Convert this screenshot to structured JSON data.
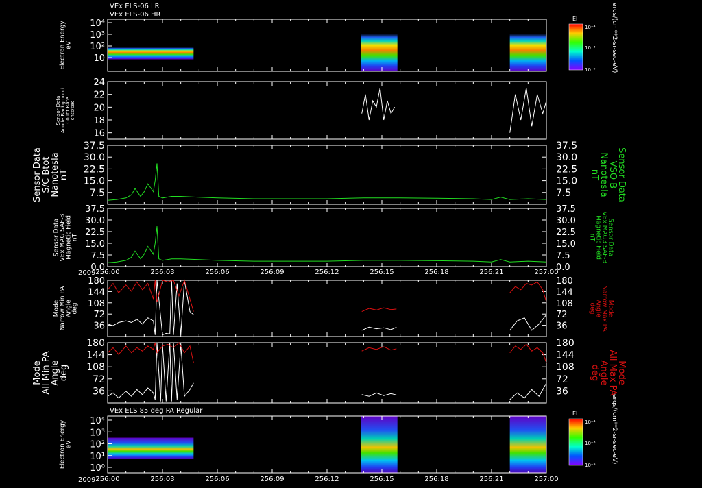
{
  "colors": {
    "background": "#000000",
    "axis": "#ffffff",
    "white_trace": "#ffffff",
    "green_trace": "#22dd22",
    "red_trace": "#dd1111"
  },
  "header": {
    "line1": "VEx ELS-06 LR",
    "line2": "VEx ELS-06 HR"
  },
  "colorbar": {
    "title": "EI",
    "ticks": [
      "10⁻⁴",
      "10⁻⁸",
      "10⁻⁹"
    ],
    "unit": "ergs/(cm**2-sr-sec-eV)"
  },
  "time_axis": {
    "year": "2009",
    "ticks": [
      "256:00",
      "256:03",
      "256:06",
      "256:09",
      "256:12",
      "256:15",
      "256:18",
      "256:21",
      "257:00"
    ]
  },
  "chart_data": [
    {
      "type": "heatmap",
      "id": "energy_top",
      "ylabel": "Electron Energy\neV",
      "yticks": [
        "10⁴",
        "10³",
        "10²",
        "10"
      ],
      "data_intervals_hours": [
        [
          0.0,
          4.7
        ],
        [
          13.85,
          15.85
        ],
        [
          22.0,
          24.0
        ]
      ]
    },
    {
      "type": "line",
      "id": "anode_bg",
      "ylabel": "Sensor Data\nAnode Background\nCount Rate\ncnts/sec",
      "ylim": [
        15,
        24
      ],
      "yticks": [
        "24",
        "22",
        "20",
        "18",
        "16"
      ],
      "series": [
        {
          "color": "white",
          "segments": [
            {
              "x": [
                13.9,
                14.1,
                14.3,
                14.5,
                14.7,
                14.9,
                15.1,
                15.3,
                15.5,
                15.7
              ],
              "y": [
                19,
                22,
                18,
                21,
                20,
                23,
                18,
                21,
                19,
                20
              ]
            },
            {
              "x": [
                22.0,
                22.3,
                22.6,
                22.9,
                23.2,
                23.5,
                23.8,
                24.0
              ],
              "y": [
                16,
                22,
                18,
                23,
                17,
                22,
                19,
                21
              ]
            }
          ]
        }
      ]
    },
    {
      "type": "line",
      "id": "sc_btot",
      "ylabel": "Sensor Data\nS/C Btot\nNanotesla\nnT",
      "ylabel_right": "Sensor Data\nVSO B\nNanotesla\nnT",
      "ylim": [
        0,
        37.5
      ],
      "yticks": [
        "37.5",
        "30.0",
        "22.5",
        "15.0",
        "7.5"
      ],
      "series": [
        {
          "color": "green",
          "x": [
            0,
            0.5,
            1.0,
            1.3,
            1.5,
            1.8,
            2.0,
            2.2,
            2.5,
            2.6,
            2.7,
            2.8,
            3.0,
            3.5,
            4.0,
            5.0,
            6.0,
            8.0,
            10.0,
            12.0,
            14.0,
            16.0,
            18.0,
            20.0,
            21.0,
            21.5,
            22.0,
            23.0,
            24.0
          ],
          "y": [
            2.5,
            3.0,
            4.0,
            6.0,
            10.0,
            5.0,
            8.0,
            13.0,
            8.0,
            15.0,
            26.0,
            5.0,
            4.0,
            5.0,
            5.0,
            4.5,
            4.0,
            3.5,
            3.5,
            3.5,
            4.0,
            4.0,
            3.8,
            3.5,
            3.0,
            4.5,
            3.0,
            3.5,
            3.0
          ]
        }
      ]
    },
    {
      "type": "line",
      "id": "mag_field",
      "ylabel": "Sensor Data\nVEx MAG SAF-B\nMagnetic Field\nnT",
      "ylabel_right": "Sensor Data\nVEx MAG3 SAF-B\nMagnetic Field\nnT",
      "ylim": [
        0,
        37.5
      ],
      "yticks": [
        "37.5",
        "30.0",
        "22.5",
        "15.0",
        "7.5",
        "0.0"
      ],
      "series": [
        {
          "color": "green",
          "x": [
            0,
            0.5,
            1.0,
            1.3,
            1.5,
            1.8,
            2.0,
            2.2,
            2.5,
            2.6,
            2.7,
            2.8,
            3.0,
            3.5,
            4.0,
            5.0,
            6.0,
            8.0,
            10.0,
            12.0,
            14.0,
            16.0,
            18.0,
            20.0,
            21.0,
            21.5,
            22.0,
            23.0,
            24.0
          ],
          "y": [
            2.5,
            3.0,
            4.0,
            6.0,
            10.0,
            5.0,
            8.0,
            13.0,
            8.0,
            15.0,
            26.0,
            5.0,
            4.0,
            5.0,
            5.0,
            4.5,
            4.0,
            3.5,
            3.5,
            3.5,
            4.0,
            4.0,
            3.8,
            3.5,
            3.0,
            4.5,
            3.0,
            3.5,
            3.0
          ]
        }
      ]
    },
    {
      "type": "line",
      "id": "narrow_pa",
      "ylabel": "Mode\nNarrow Min PA\nAngle\ndeg",
      "ylabel_right": "Mode\nNarrow Max PA\nAngle\ndeg",
      "ylim": [
        0,
        180
      ],
      "yticks": [
        "180",
        "144",
        "108",
        "72",
        "36"
      ],
      "series": [
        {
          "name": "min",
          "color": "white",
          "segments": [
            {
              "x": [
                0,
                0.3,
                0.6,
                1.0,
                1.3,
                1.6,
                1.9,
                2.2,
                2.5,
                2.6,
                2.7,
                3.0,
                3.2,
                3.4,
                3.5,
                3.6,
                3.8,
                4.0,
                4.2,
                4.5,
                4.7
              ],
              "y": [
                40,
                35,
                45,
                50,
                45,
                55,
                40,
                60,
                50,
                5,
                180,
                5,
                10,
                8,
                180,
                5,
                170,
                5,
                180,
                80,
                70
              ]
            },
            {
              "x": [
                13.9,
                14.3,
                14.7,
                15.1,
                15.5,
                15.8
              ],
              "y": [
                20,
                30,
                25,
                28,
                22,
                30
              ]
            },
            {
              "x": [
                22.0,
                22.4,
                22.8,
                23.2,
                23.6,
                24.0
              ],
              "y": [
                20,
                50,
                60,
                20,
                40,
                70
              ]
            }
          ]
        },
        {
          "name": "max",
          "color": "red",
          "segments": [
            {
              "x": [
                0,
                0.3,
                0.6,
                1.0,
                1.3,
                1.6,
                1.9,
                2.2,
                2.5,
                2.6,
                2.7,
                3.0,
                3.3,
                3.6,
                3.9,
                4.2,
                4.5,
                4.7
              ],
              "y": [
                150,
                170,
                140,
                165,
                145,
                175,
                150,
                170,
                120,
                180,
                110,
                180,
                175,
                180,
                130,
                180,
                120,
                80
              ]
            },
            {
              "x": [
                13.9,
                14.3,
                14.7,
                15.1,
                15.5,
                15.8
              ],
              "y": [
                80,
                90,
                85,
                92,
                86,
                88
              ]
            },
            {
              "x": [
                22.0,
                22.3,
                22.6,
                22.9,
                23.2,
                23.5,
                23.8,
                24.0
              ],
              "y": [
                140,
                160,
                150,
                170,
                165,
                175,
                150,
                110
              ]
            }
          ]
        }
      ]
    },
    {
      "type": "line",
      "id": "all_pa",
      "ylabel": "Mode\nAll Min PA\nAngle\ndeg",
      "ylabel_right": "Mode\nAll Max PA\nAngle\ndeg",
      "ylim": [
        0,
        180
      ],
      "yticks": [
        "180",
        "144",
        "108",
        "72",
        "36"
      ],
      "series": [
        {
          "name": "min",
          "color": "white",
          "segments": [
            {
              "x": [
                0,
                0.3,
                0.6,
                1.0,
                1.3,
                1.6,
                1.9,
                2.2,
                2.5,
                2.6,
                2.7,
                2.9,
                3.0,
                3.2,
                3.4,
                3.5,
                3.6,
                3.8,
                4.0,
                4.2,
                4.5,
                4.7
              ],
              "y": [
                20,
                30,
                15,
                35,
                20,
                40,
                25,
                45,
                30,
                10,
                180,
                5,
                175,
                5,
                180,
                5,
                180,
                10,
                175,
                20,
                40,
                60
              ]
            },
            {
              "x": [
                13.9,
                14.3,
                14.7,
                15.1,
                15.5,
                15.8
              ],
              "y": [
                25,
                20,
                30,
                22,
                28,
                24
              ]
            },
            {
              "x": [
                22.0,
                22.4,
                22.8,
                23.2,
                23.6,
                24.0
              ],
              "y": [
                10,
                30,
                15,
                40,
                20,
                60
              ]
            }
          ]
        },
        {
          "name": "max",
          "color": "red",
          "segments": [
            {
              "x": [
                0,
                0.3,
                0.6,
                1.0,
                1.3,
                1.6,
                1.9,
                2.2,
                2.5,
                2.6,
                2.7,
                3.0,
                3.3,
                3.6,
                3.9,
                4.2,
                4.5,
                4.7
              ],
              "y": [
                150,
                165,
                145,
                170,
                150,
                165,
                155,
                170,
                160,
                180,
                150,
                170,
                175,
                165,
                180,
                150,
                170,
                120
              ]
            },
            {
              "x": [
                13.9,
                14.3,
                14.7,
                15.1,
                15.5,
                15.8
              ],
              "y": [
                155,
                165,
                160,
                168,
                158,
                162
              ]
            },
            {
              "x": [
                22.0,
                22.3,
                22.6,
                22.9,
                23.2,
                23.5,
                23.8,
                24.0
              ],
              "y": [
                150,
                170,
                160,
                175,
                155,
                165,
                150,
                120
              ]
            }
          ]
        }
      ]
    },
    {
      "type": "heatmap",
      "id": "energy_bottom",
      "title": "VEx ELS 85 deg PA Regular",
      "ylabel": "Electron Energy\neV",
      "yticks": [
        "10⁴",
        "10³",
        "10²",
        "10¹",
        "10⁰"
      ],
      "data_intervals_hours": [
        [
          0.0,
          4.7
        ],
        [
          13.85,
          15.85
        ],
        [
          22.0,
          24.0
        ]
      ]
    }
  ]
}
